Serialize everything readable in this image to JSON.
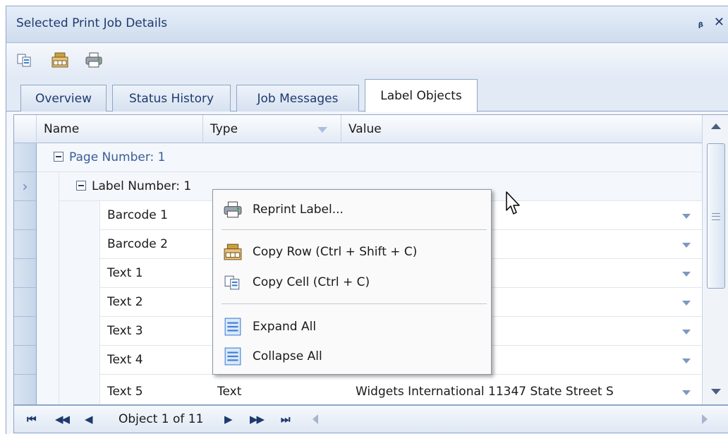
{
  "panel": {
    "title": "Selected Print Job Details",
    "pin_glyph": "ᵦ",
    "close_glyph": "✕"
  },
  "toolbar": {
    "buttons": [
      {
        "icon": "copy-cell-icon"
      },
      {
        "icon": "copy-row-icon"
      },
      {
        "icon": "printer-icon"
      }
    ]
  },
  "tabs": [
    {
      "label": "Overview",
      "active": false
    },
    {
      "label": "Status History",
      "active": false
    },
    {
      "label": "Job Messages",
      "active": false
    },
    {
      "label": "Label Objects",
      "active": true
    }
  ],
  "grid": {
    "columns": [
      "Name",
      "Type",
      "Value"
    ],
    "group_page": "Page Number: 1",
    "group_label": "Label Number: 1",
    "rows": [
      {
        "name": "Barcode 1",
        "type": "",
        "value": ""
      },
      {
        "name": "Barcode 2",
        "type": "",
        "value": ""
      },
      {
        "name": "Text 1",
        "type": "",
        "value": ""
      },
      {
        "name": "Text 2",
        "type": "",
        "value": ""
      },
      {
        "name": "Text 3",
        "type": "",
        "value": ""
      },
      {
        "name": "Text 4",
        "type": "",
        "value": ""
      },
      {
        "name": "Text 5",
        "type": "Text",
        "value": "Widgets International 11347 State Street S"
      }
    ],
    "current_row_glyph": "›"
  },
  "navigator": {
    "first": "⏮",
    "prev_page": "◀◀",
    "prev": "◀",
    "position": "Object 1 of 11",
    "next": "▶",
    "next_page": "▶▶",
    "last": "⏭"
  },
  "context_menu": {
    "items": [
      {
        "label": "Reprint Label...",
        "icon": "printer-icon"
      },
      {
        "label": "Copy Row (Ctrl + Shift + C)",
        "icon": "copy-row-icon"
      },
      {
        "label": "Copy Cell (Ctrl + C)",
        "icon": "copy-cell-icon"
      },
      {
        "label": "Expand All",
        "icon": "expand-all-icon"
      },
      {
        "label": "Collapse All",
        "icon": "collapse-all-icon"
      }
    ]
  },
  "colors": {
    "accent": "#1e3a6d",
    "border": "#8ea6c8",
    "header_bg": "#d6e1f0"
  }
}
